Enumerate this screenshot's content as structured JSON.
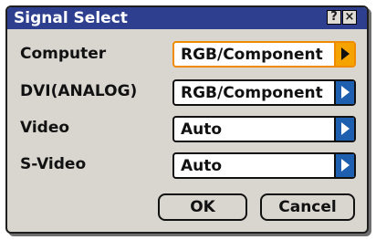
{
  "dialog": {
    "title": "Signal Select",
    "help_glyph": "?",
    "close_glyph": "×"
  },
  "rows": [
    {
      "label": "Computer",
      "value": "RGB/Component",
      "focused": true
    },
    {
      "label": "DVI(ANALOG)",
      "value": "RGB/Component",
      "focused": false
    },
    {
      "label": "Video",
      "value": "Auto",
      "focused": false
    },
    {
      "label": "S-Video",
      "value": "Auto",
      "focused": false
    }
  ],
  "buttons": {
    "ok": "OK",
    "cancel": "Cancel"
  },
  "colors": {
    "titlebar": "#2e3f8f",
    "focus": "#f5a300",
    "arrow": "#1f5fb0",
    "dialog_bg": "#d9d6d0"
  },
  "icons": {
    "help": "help-icon",
    "close": "close-icon",
    "dropdown": "triangle-right-icon"
  }
}
